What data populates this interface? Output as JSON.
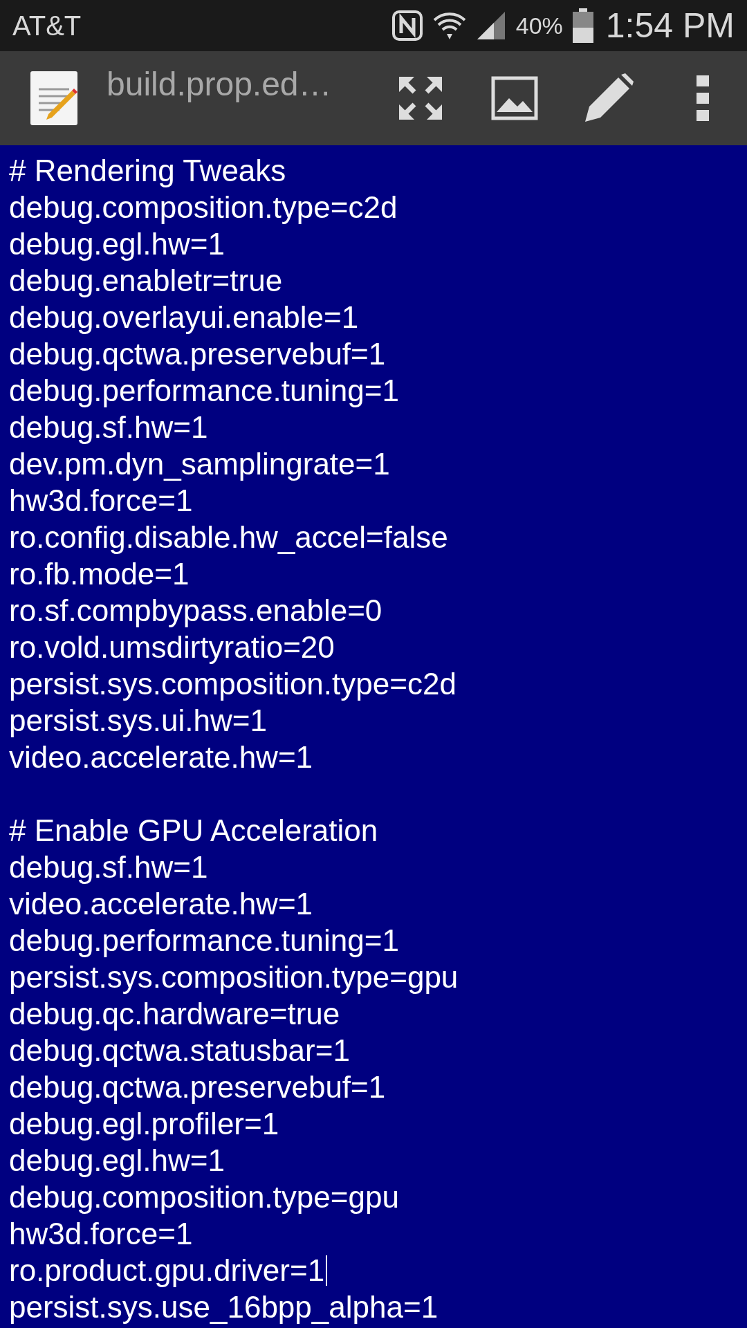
{
  "status_bar": {
    "carrier": "AT&T",
    "battery": "40%",
    "time": "1:54 PM"
  },
  "toolbar": {
    "title": "build.prop.ed…"
  },
  "editor": {
    "sections": [
      {
        "lines": [
          {
            "text": "# Rendering Tweaks",
            "cursor": false
          },
          {
            "text": "debug.composition.type=c2d",
            "cursor": false
          },
          {
            "text": "debug.egl.hw=1",
            "cursor": false
          },
          {
            "text": "debug.enabletr=true",
            "cursor": false
          },
          {
            "text": "debug.overlayui.enable=1",
            "cursor": false
          },
          {
            "text": "debug.qctwa.preservebuf=1",
            "cursor": false
          },
          {
            "text": "debug.performance.tuning=1",
            "cursor": false
          },
          {
            "text": "debug.sf.hw=1",
            "cursor": false
          },
          {
            "text": "dev.pm.dyn_samplingrate=1",
            "cursor": false
          },
          {
            "text": "hw3d.force=1",
            "cursor": false
          },
          {
            "text": "ro.config.disable.hw_accel=false",
            "cursor": false
          },
          {
            "text": "ro.fb.mode=1",
            "cursor": false
          },
          {
            "text": "ro.sf.compbypass.enable=0",
            "cursor": false
          },
          {
            "text": "ro.vold.umsdirtyratio=20",
            "cursor": false
          },
          {
            "text": "persist.sys.composition.type=c2d",
            "cursor": false
          },
          {
            "text": "persist.sys.ui.hw=1",
            "cursor": false
          },
          {
            "text": "video.accelerate.hw=1",
            "cursor": false
          }
        ]
      },
      {
        "lines": [
          {
            "text": "# Enable GPU Acceleration",
            "cursor": false
          },
          {
            "text": "debug.sf.hw=1",
            "cursor": false
          },
          {
            "text": "video.accelerate.hw=1",
            "cursor": false
          },
          {
            "text": "debug.performance.tuning=1",
            "cursor": false
          },
          {
            "text": "persist.sys.composition.type=gpu",
            "cursor": false
          },
          {
            "text": "debug.qc.hardware=true",
            "cursor": false
          },
          {
            "text": "debug.qctwa.statusbar=1",
            "cursor": false
          },
          {
            "text": "debug.qctwa.preservebuf=1",
            "cursor": false
          },
          {
            "text": "debug.egl.profiler=1",
            "cursor": false
          },
          {
            "text": "debug.egl.hw=1",
            "cursor": false
          },
          {
            "text": "debug.composition.type=gpu",
            "cursor": false
          },
          {
            "text": "hw3d.force=1",
            "cursor": false
          },
          {
            "text": "ro.product.gpu.driver=1",
            "cursor": true
          },
          {
            "text": "persist.sys.use_16bpp_alpha=1",
            "cursor": false
          }
        ]
      }
    ]
  }
}
